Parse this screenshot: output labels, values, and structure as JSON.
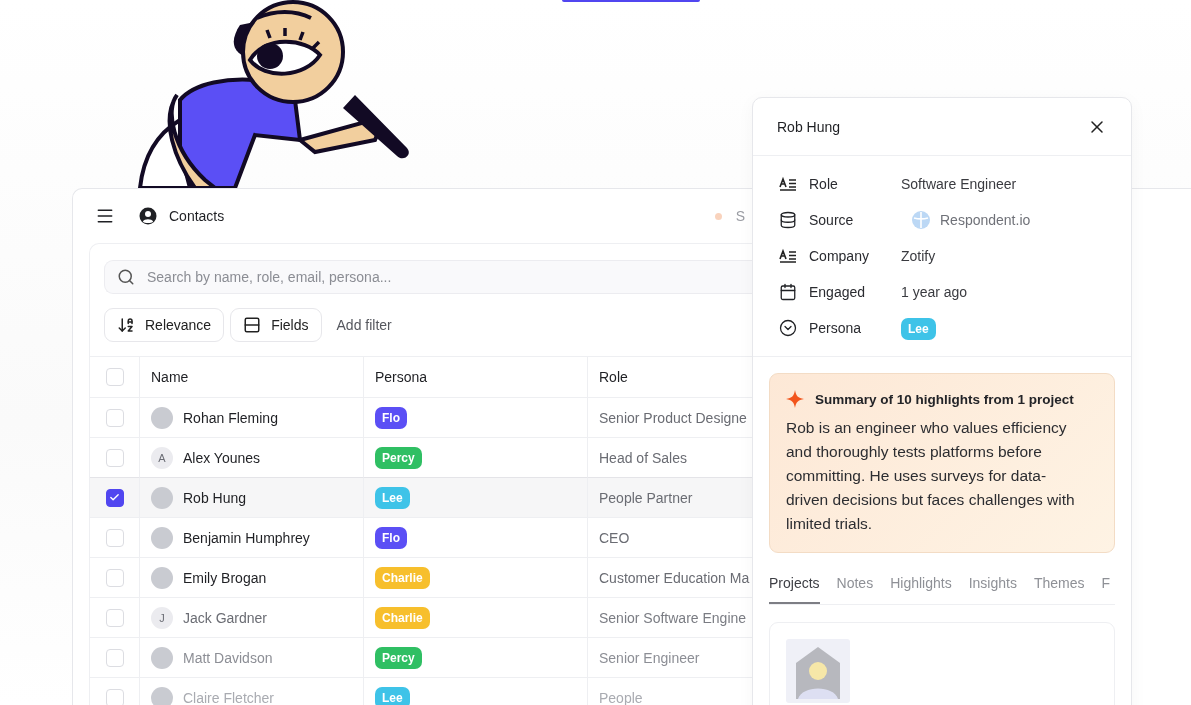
{
  "header": {
    "title": "Contacts",
    "status_text": "S"
  },
  "search": {
    "placeholder": "Search by name, role, email, persona..."
  },
  "toolbar": {
    "sort_button": "Relevance",
    "fields_button": "Fields",
    "filter_link": "Add filter"
  },
  "table": {
    "columns": [
      "Name",
      "Persona",
      "Role"
    ],
    "all_checked": false,
    "rows": [
      {
        "name": "Rohan Fleming",
        "avatar": {
          "kind": "photo"
        },
        "persona": {
          "label": "Flo",
          "color": "#5b4ff5"
        },
        "role": "Senior Product Designe",
        "selected": false
      },
      {
        "name": "Alex Younes",
        "avatar": {
          "kind": "initial",
          "initial": "A"
        },
        "persona": {
          "label": "Percy",
          "color": "#2fbf63"
        },
        "role": "Head of Sales",
        "selected": false
      },
      {
        "name": "Rob Hung",
        "avatar": {
          "kind": "photo"
        },
        "persona": {
          "label": "Lee",
          "color": "#3ec3e8"
        },
        "role": "People Partner",
        "selected": true
      },
      {
        "name": "Benjamin Humphrey",
        "avatar": {
          "kind": "photo"
        },
        "persona": {
          "label": "Flo",
          "color": "#5b4ff5"
        },
        "role": "CEO",
        "selected": false
      },
      {
        "name": "Emily Brogan",
        "avatar": {
          "kind": "photo"
        },
        "persona": {
          "label": "Charlie",
          "color": "#f7bf2c"
        },
        "role": "Customer Education Ma",
        "selected": false
      },
      {
        "name": "Jack Gardner",
        "avatar": {
          "kind": "initial",
          "initial": "J"
        },
        "persona": {
          "label": "Charlie",
          "color": "#f7bf2c"
        },
        "role": "Senior Software Engine",
        "selected": false
      },
      {
        "name": "Matt Davidson",
        "avatar": {
          "kind": "photo"
        },
        "persona": {
          "label": "Percy",
          "color": "#2fbf63"
        },
        "role": "Senior Engineer",
        "selected": false
      },
      {
        "name": "Claire Fletcher",
        "avatar": {
          "kind": "photo"
        },
        "persona": {
          "label": "Lee",
          "color": "#3ec3e8"
        },
        "role": "People",
        "selected": false
      }
    ]
  },
  "detail": {
    "title": "Rob Hung",
    "fields": [
      {
        "kind": "text",
        "label": "Role",
        "value": "Software Engineer"
      },
      {
        "kind": "source",
        "label": "Source",
        "value": "Respondent.io"
      },
      {
        "kind": "text",
        "label": "Company",
        "value": "Zotify"
      },
      {
        "kind": "text",
        "label": "Engaged",
        "value": "1 year ago"
      },
      {
        "kind": "badge",
        "label": "Persona",
        "value": "Lee",
        "color": "#3ec3e8"
      }
    ],
    "summary": {
      "title": "Summary of 10 highlights from 1 project",
      "body": "Rob is an engineer who values efficiency and thoroughly tests platforms before committing. He uses surveys for data-driven decisions but faces challenges with limited trials."
    },
    "tabs": [
      {
        "label": "Projects",
        "selected": true
      },
      {
        "label": "Notes",
        "selected": false
      },
      {
        "label": "Highlights",
        "selected": false
      },
      {
        "label": "Insights",
        "selected": false
      },
      {
        "label": "Themes",
        "selected": false
      },
      {
        "label": "F",
        "selected": false
      }
    ]
  }
}
